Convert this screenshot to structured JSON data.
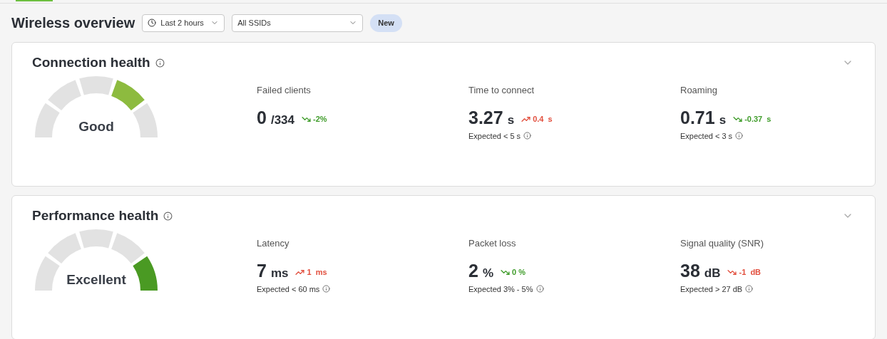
{
  "title": "Wireless overview",
  "filters": [
    {
      "kind": "time",
      "value": "Last 2 hours"
    },
    {
      "kind": "select",
      "value": "All SSIDs"
    }
  ],
  "badge": "New",
  "cards": [
    {
      "title": "Connection health",
      "status": "Good",
      "color": "#8dbb3f",
      "segments": [
        {
          "selected": false
        },
        {
          "selected": false
        },
        {
          "selected": false
        },
        {
          "selected": true
        },
        {
          "selected": false
        }
      ],
      "metrics": [
        {
          "label": "Failed clients",
          "value": "0",
          "unit": "/334",
          "trend": {
            "kind": "down-good",
            "value": "-2%"
          }
        },
        {
          "label": "Time to connect",
          "value": "3.27",
          "unit": "s",
          "trend": {
            "kind": "up-bad",
            "value": "0.4  s"
          },
          "expected": "Expected < 5 s"
        },
        {
          "label": "Roaming",
          "value": "0.71",
          "unit": "s",
          "trend": {
            "kind": "down-good",
            "value": "-0.37  s"
          },
          "expected": "Expected < 3 s"
        }
      ]
    },
    {
      "title": "Performance health",
      "status": "Excellent",
      "color": "#4a9a23",
      "segments": [
        {
          "selected": false
        },
        {
          "selected": false
        },
        {
          "selected": false
        },
        {
          "selected": false
        },
        {
          "selected": true
        }
      ],
      "metrics": [
        {
          "label": "Latency",
          "value": "7",
          "unit": "ms",
          "trend": {
            "kind": "up-bad",
            "value": "1  ms"
          },
          "expected": "Expected < 60 ms"
        },
        {
          "label": "Packet loss",
          "value": "2",
          "unit": "%",
          "trend": {
            "kind": "down-good",
            "value": "0 %"
          },
          "expected": "Expected 3% - 5%"
        },
        {
          "label": "Signal quality (SNR)",
          "value": "38",
          "unit": "dB",
          "trend": {
            "kind": "down-bad",
            "value": "-1  dB"
          },
          "expected": "Expected > 27 dB"
        }
      ]
    }
  ]
}
